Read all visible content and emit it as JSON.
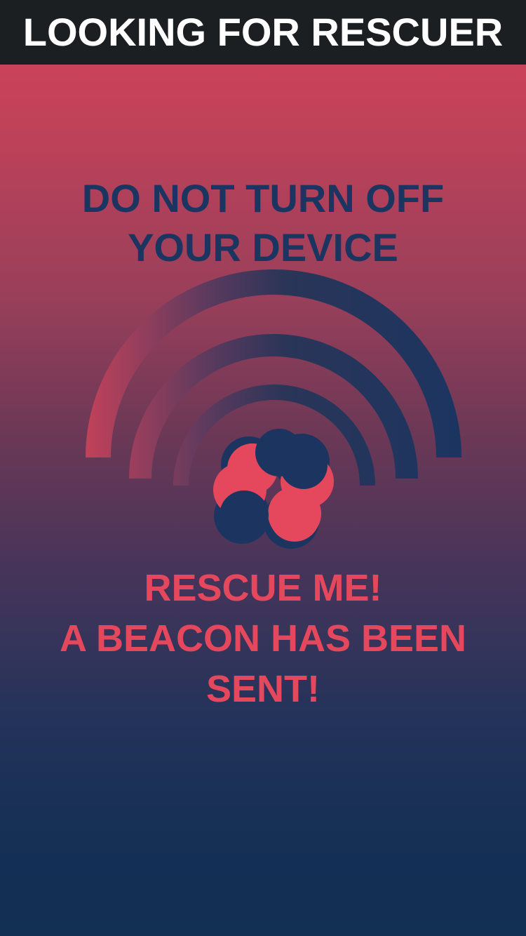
{
  "header": {
    "title": "LOOKING FOR RESCUER"
  },
  "warning": {
    "line1": "DO NOT TURN OFF",
    "line2": "YOUR DEVICE"
  },
  "status": {
    "line1": "RESCUE ME!",
    "line2": "A BEACON HAS BEEN",
    "line3": "SENT!"
  },
  "icons": {
    "signal": "signal-waves-icon",
    "beacon": "beacon-logo-icon"
  },
  "colors": {
    "header_bg": "#1c1f22",
    "header_text": "#ffffff",
    "warning_text": "#1c3560",
    "status_text": "#e5475c",
    "logo_red": "#e5475c",
    "logo_navy": "#1c3560"
  }
}
